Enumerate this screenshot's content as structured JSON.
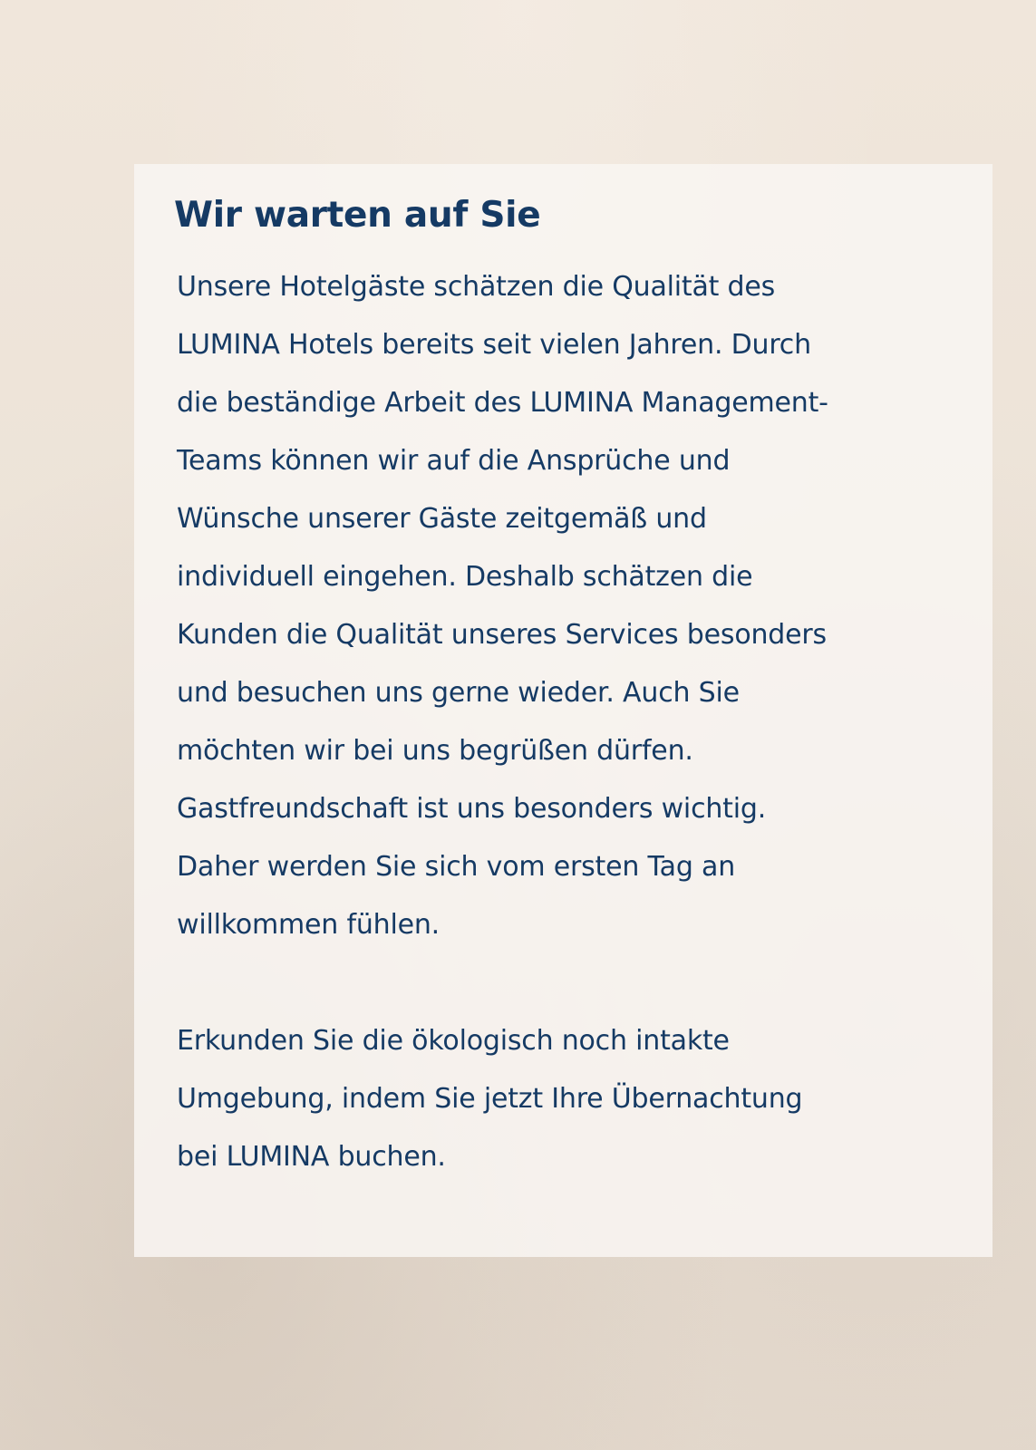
{
  "heading": "Wir warten auf Sie",
  "paragraph1": {
    "lines": [
      "Unsere Hotelgäste schätzen die Qualität des",
      "LUMINA Hotels bereits seit vielen Jahren. Durch",
      "die beständige Arbeit des LUMINA Management-",
      "Teams können wir auf die Ansprüche und",
      "Wünsche unserer Gäste zeitgemäß und",
      "individuell eingehen. Deshalb schätzen die",
      "Kunden die Qualität unseres Services besonders",
      "und besuchen uns gerne wieder. Auch Sie",
      "möchten wir bei uns begrüßen dürfen.",
      "Gastfreundschaft ist uns besonders wichtig.",
      "Daher werden Sie sich vom ersten Tag an",
      "willkommen fühlen."
    ]
  },
  "paragraph2": {
    "lines": [
      "Erkunden Sie die ökologisch noch intakte",
      "Umgebung, indem Sie jetzt Ihre Übernachtung",
      "bei LUMINA buchen."
    ]
  },
  "colors": {
    "text": "#153a64",
    "panel": "#f8f5f1",
    "background": "#ede3d8"
  }
}
